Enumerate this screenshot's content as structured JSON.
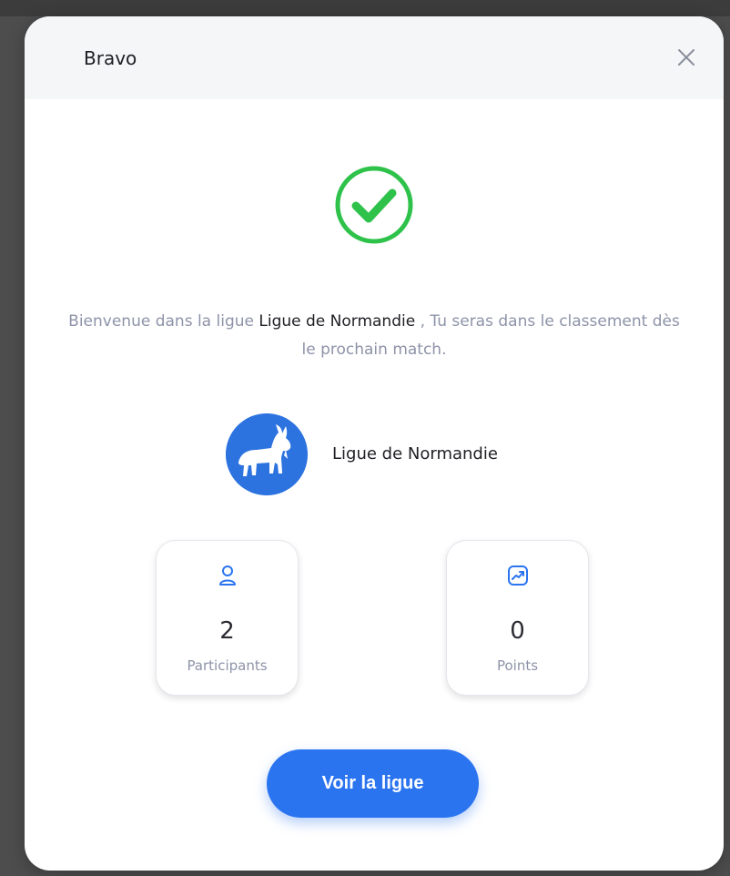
{
  "modal": {
    "title": "Bravo",
    "close_icon": "close-icon",
    "success_icon": "check-circle-icon",
    "accent_color": "#2b74f0",
    "success_color": "#2ec24a"
  },
  "welcome": {
    "prefix": "Bienvenue dans la ligue",
    "league_name": "Ligue de Normandie",
    "suffix": " , Tu seras dans le classement dès le prochain match."
  },
  "league": {
    "name": "Ligue de Normandie",
    "avatar_icon": "goat-logo-icon"
  },
  "stats": {
    "participants": {
      "icon": "user-icon",
      "value": "2",
      "label": "Participants"
    },
    "points": {
      "icon": "trend-chart-icon",
      "value": "0",
      "label": "Points"
    }
  },
  "cta": {
    "label": "Voir la ligue"
  }
}
